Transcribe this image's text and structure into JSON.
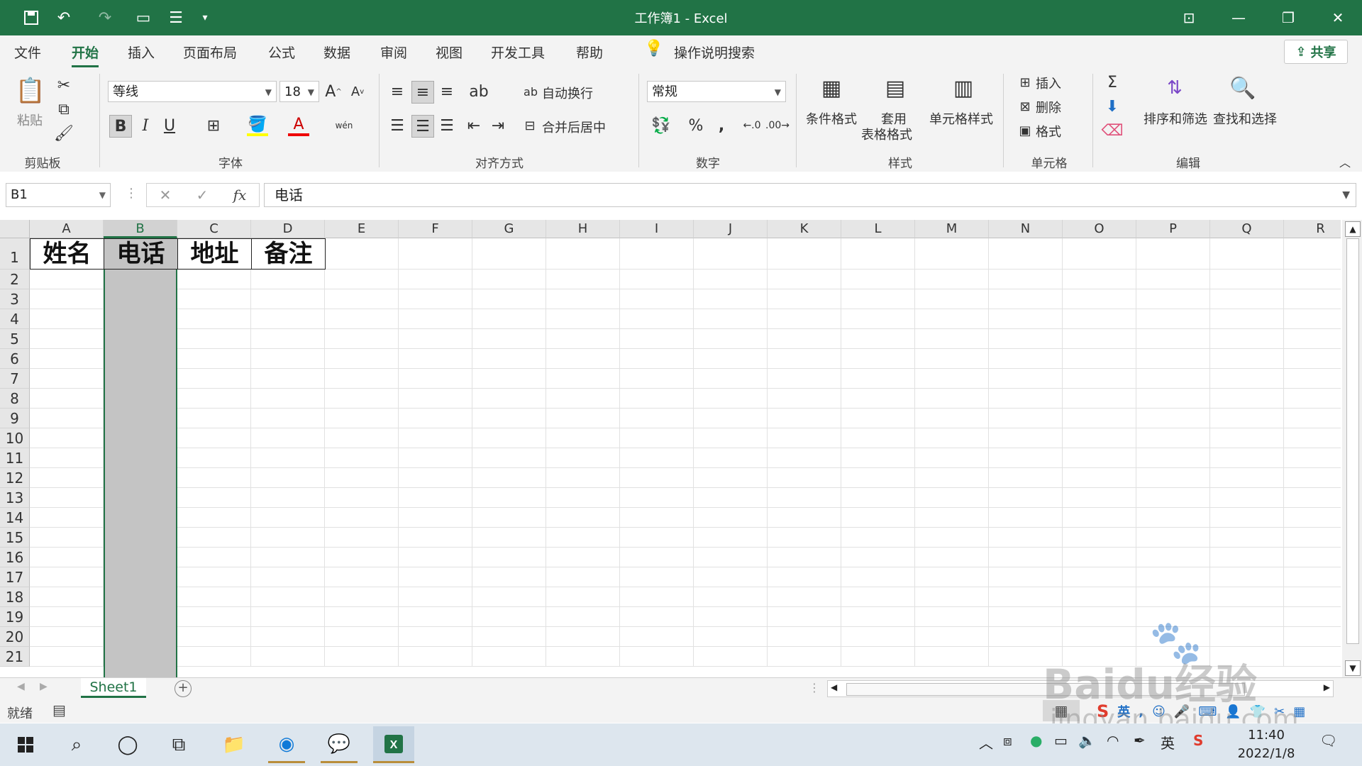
{
  "titlebar": {
    "title": "工作簿1  -  Excel"
  },
  "menu": {
    "tabs": [
      "文件",
      "开始",
      "插入",
      "页面布局",
      "公式",
      "数据",
      "审阅",
      "视图",
      "开发工具",
      "帮助"
    ],
    "active_tab": "开始",
    "search_label": "操作说明搜索",
    "share_label": "共享"
  },
  "ribbon": {
    "clipboard": {
      "paste": "粘贴",
      "label": "剪贴板"
    },
    "font": {
      "name": "等线",
      "size": "18",
      "bold": "B",
      "italic": "I",
      "underline": "U",
      "phonetic": "wén",
      "label": "字体"
    },
    "alignment": {
      "wrap": "自动换行",
      "merge": "合并后居中",
      "label": "对齐方式"
    },
    "number": {
      "format": "常规",
      "percent": "%",
      "comma": ",",
      "label": "数字"
    },
    "styles": {
      "conditional": "条件格式",
      "table_line1": "套用",
      "table_line2": "表格格式",
      "cell_styles": "单元格样式",
      "label": "样式"
    },
    "cells": {
      "insert": "插入",
      "delete": "删除",
      "format": "格式",
      "label": "单元格"
    },
    "editing": {
      "sort": "排序和筛选",
      "find": "查找和选择",
      "label": "编辑"
    }
  },
  "formula": {
    "name_box": "B1",
    "content": "电话"
  },
  "grid": {
    "columns": [
      "A",
      "B",
      "C",
      "D",
      "E",
      "F",
      "G",
      "H",
      "I",
      "J",
      "K",
      "L",
      "M",
      "N",
      "O",
      "P",
      "Q",
      "R"
    ],
    "rows": [
      "1",
      "2",
      "3",
      "4",
      "5",
      "6",
      "7",
      "8",
      "9",
      "10",
      "11",
      "12",
      "13",
      "14",
      "15",
      "16",
      "17",
      "18",
      "19",
      "20",
      "21"
    ],
    "selected_column": "B",
    "headers": [
      "姓名",
      "电话",
      "地址",
      "备注"
    ]
  },
  "sheet": {
    "tab": "Sheet1",
    "add": "+"
  },
  "status": {
    "ready": "就绪"
  },
  "taskbar": {
    "time": "11:40",
    "date": "2022/1/8",
    "ime": "英"
  },
  "watermark": {
    "line1": "Baidu经验",
    "line2": "jingyan.baidu.com"
  },
  "colors": {
    "excel_green": "#217346",
    "selection_gray": "#c4c4c4"
  }
}
